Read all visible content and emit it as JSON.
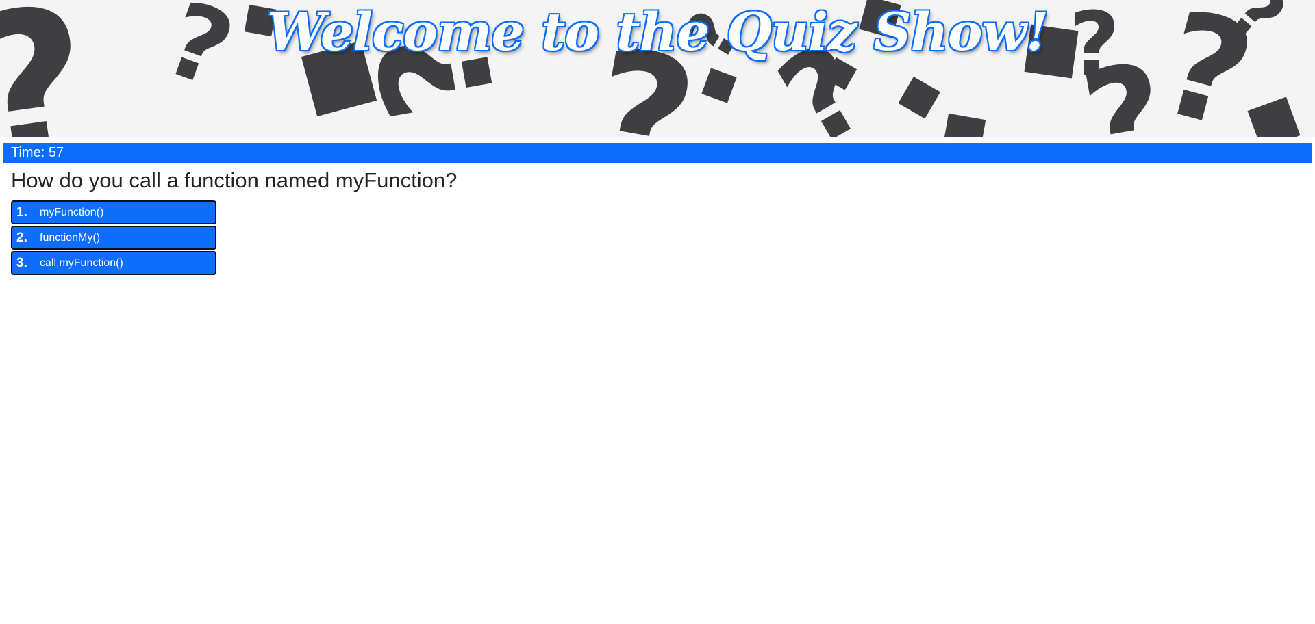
{
  "header": {
    "title": "Welcome to the Quiz Show!"
  },
  "timer": {
    "text": "Time: 57"
  },
  "quiz": {
    "question": "How do you call a function named myFunction?",
    "answers": [
      {
        "number": "1.",
        "label": "myFunction()"
      },
      {
        "number": "2.",
        "label": "functionMy()"
      },
      {
        "number": "3.",
        "label": "call,myFunction()"
      }
    ]
  },
  "colors": {
    "accent": "#0d6efd",
    "banner_shapes": "#3f3f42",
    "text": "#212529"
  }
}
